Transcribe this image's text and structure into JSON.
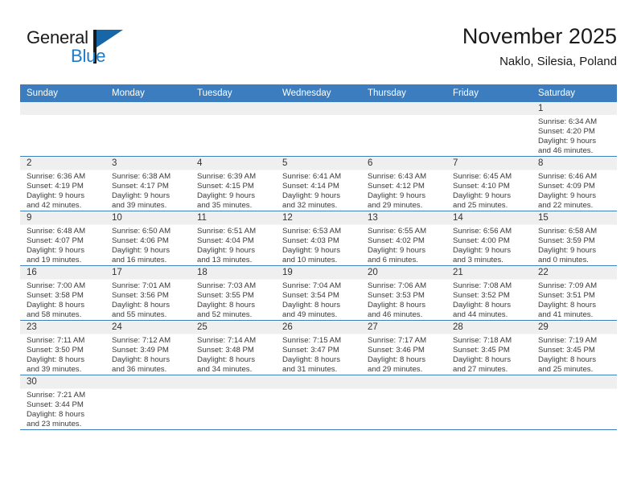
{
  "brand": {
    "name_top": "General",
    "name_bottom": "Blue",
    "accent_color": "#1f7ac6",
    "triangle_icon": "brand-triangle-icon"
  },
  "header": {
    "month_title": "November 2025",
    "location": "Naklo, Silesia, Poland",
    "header_bg_color": "#3b7dbf"
  },
  "weekdays": [
    "Sunday",
    "Monday",
    "Tuesday",
    "Wednesday",
    "Thursday",
    "Friday",
    "Saturday"
  ],
  "labels": {
    "sunrise_prefix": "Sunrise: ",
    "sunset_prefix": "Sunset: ",
    "daylight_prefix": "Daylight: "
  },
  "weeks": [
    [
      {
        "day": "",
        "lines": []
      },
      {
        "day": "",
        "lines": []
      },
      {
        "day": "",
        "lines": []
      },
      {
        "day": "",
        "lines": []
      },
      {
        "day": "",
        "lines": []
      },
      {
        "day": "",
        "lines": []
      },
      {
        "day": "1",
        "lines": [
          "Sunrise: 6:34 AM",
          "Sunset: 4:20 PM",
          "Daylight: 9 hours",
          "and 46 minutes."
        ]
      }
    ],
    [
      {
        "day": "2",
        "lines": [
          "Sunrise: 6:36 AM",
          "Sunset: 4:19 PM",
          "Daylight: 9 hours",
          "and 42 minutes."
        ]
      },
      {
        "day": "3",
        "lines": [
          "Sunrise: 6:38 AM",
          "Sunset: 4:17 PM",
          "Daylight: 9 hours",
          "and 39 minutes."
        ]
      },
      {
        "day": "4",
        "lines": [
          "Sunrise: 6:39 AM",
          "Sunset: 4:15 PM",
          "Daylight: 9 hours",
          "and 35 minutes."
        ]
      },
      {
        "day": "5",
        "lines": [
          "Sunrise: 6:41 AM",
          "Sunset: 4:14 PM",
          "Daylight: 9 hours",
          "and 32 minutes."
        ]
      },
      {
        "day": "6",
        "lines": [
          "Sunrise: 6:43 AM",
          "Sunset: 4:12 PM",
          "Daylight: 9 hours",
          "and 29 minutes."
        ]
      },
      {
        "day": "7",
        "lines": [
          "Sunrise: 6:45 AM",
          "Sunset: 4:10 PM",
          "Daylight: 9 hours",
          "and 25 minutes."
        ]
      },
      {
        "day": "8",
        "lines": [
          "Sunrise: 6:46 AM",
          "Sunset: 4:09 PM",
          "Daylight: 9 hours",
          "and 22 minutes."
        ]
      }
    ],
    [
      {
        "day": "9",
        "lines": [
          "Sunrise: 6:48 AM",
          "Sunset: 4:07 PM",
          "Daylight: 9 hours",
          "and 19 minutes."
        ]
      },
      {
        "day": "10",
        "lines": [
          "Sunrise: 6:50 AM",
          "Sunset: 4:06 PM",
          "Daylight: 9 hours",
          "and 16 minutes."
        ]
      },
      {
        "day": "11",
        "lines": [
          "Sunrise: 6:51 AM",
          "Sunset: 4:04 PM",
          "Daylight: 9 hours",
          "and 13 minutes."
        ]
      },
      {
        "day": "12",
        "lines": [
          "Sunrise: 6:53 AM",
          "Sunset: 4:03 PM",
          "Daylight: 9 hours",
          "and 10 minutes."
        ]
      },
      {
        "day": "13",
        "lines": [
          "Sunrise: 6:55 AM",
          "Sunset: 4:02 PM",
          "Daylight: 9 hours",
          "and 6 minutes."
        ]
      },
      {
        "day": "14",
        "lines": [
          "Sunrise: 6:56 AM",
          "Sunset: 4:00 PM",
          "Daylight: 9 hours",
          "and 3 minutes."
        ]
      },
      {
        "day": "15",
        "lines": [
          "Sunrise: 6:58 AM",
          "Sunset: 3:59 PM",
          "Daylight: 9 hours",
          "and 0 minutes."
        ]
      }
    ],
    [
      {
        "day": "16",
        "lines": [
          "Sunrise: 7:00 AM",
          "Sunset: 3:58 PM",
          "Daylight: 8 hours",
          "and 58 minutes."
        ]
      },
      {
        "day": "17",
        "lines": [
          "Sunrise: 7:01 AM",
          "Sunset: 3:56 PM",
          "Daylight: 8 hours",
          "and 55 minutes."
        ]
      },
      {
        "day": "18",
        "lines": [
          "Sunrise: 7:03 AM",
          "Sunset: 3:55 PM",
          "Daylight: 8 hours",
          "and 52 minutes."
        ]
      },
      {
        "day": "19",
        "lines": [
          "Sunrise: 7:04 AM",
          "Sunset: 3:54 PM",
          "Daylight: 8 hours",
          "and 49 minutes."
        ]
      },
      {
        "day": "20",
        "lines": [
          "Sunrise: 7:06 AM",
          "Sunset: 3:53 PM",
          "Daylight: 8 hours",
          "and 46 minutes."
        ]
      },
      {
        "day": "21",
        "lines": [
          "Sunrise: 7:08 AM",
          "Sunset: 3:52 PM",
          "Daylight: 8 hours",
          "and 44 minutes."
        ]
      },
      {
        "day": "22",
        "lines": [
          "Sunrise: 7:09 AM",
          "Sunset: 3:51 PM",
          "Daylight: 8 hours",
          "and 41 minutes."
        ]
      }
    ],
    [
      {
        "day": "23",
        "lines": [
          "Sunrise: 7:11 AM",
          "Sunset: 3:50 PM",
          "Daylight: 8 hours",
          "and 39 minutes."
        ]
      },
      {
        "day": "24",
        "lines": [
          "Sunrise: 7:12 AM",
          "Sunset: 3:49 PM",
          "Daylight: 8 hours",
          "and 36 minutes."
        ]
      },
      {
        "day": "25",
        "lines": [
          "Sunrise: 7:14 AM",
          "Sunset: 3:48 PM",
          "Daylight: 8 hours",
          "and 34 minutes."
        ]
      },
      {
        "day": "26",
        "lines": [
          "Sunrise: 7:15 AM",
          "Sunset: 3:47 PM",
          "Daylight: 8 hours",
          "and 31 minutes."
        ]
      },
      {
        "day": "27",
        "lines": [
          "Sunrise: 7:17 AM",
          "Sunset: 3:46 PM",
          "Daylight: 8 hours",
          "and 29 minutes."
        ]
      },
      {
        "day": "28",
        "lines": [
          "Sunrise: 7:18 AM",
          "Sunset: 3:45 PM",
          "Daylight: 8 hours",
          "and 27 minutes."
        ]
      },
      {
        "day": "29",
        "lines": [
          "Sunrise: 7:19 AM",
          "Sunset: 3:45 PM",
          "Daylight: 8 hours",
          "and 25 minutes."
        ]
      }
    ],
    [
      {
        "day": "30",
        "lines": [
          "Sunrise: 7:21 AM",
          "Sunset: 3:44 PM",
          "Daylight: 8 hours",
          "and 23 minutes."
        ]
      },
      {
        "day": "",
        "lines": []
      },
      {
        "day": "",
        "lines": []
      },
      {
        "day": "",
        "lines": []
      },
      {
        "day": "",
        "lines": []
      },
      {
        "day": "",
        "lines": []
      },
      {
        "day": "",
        "lines": []
      }
    ]
  ]
}
